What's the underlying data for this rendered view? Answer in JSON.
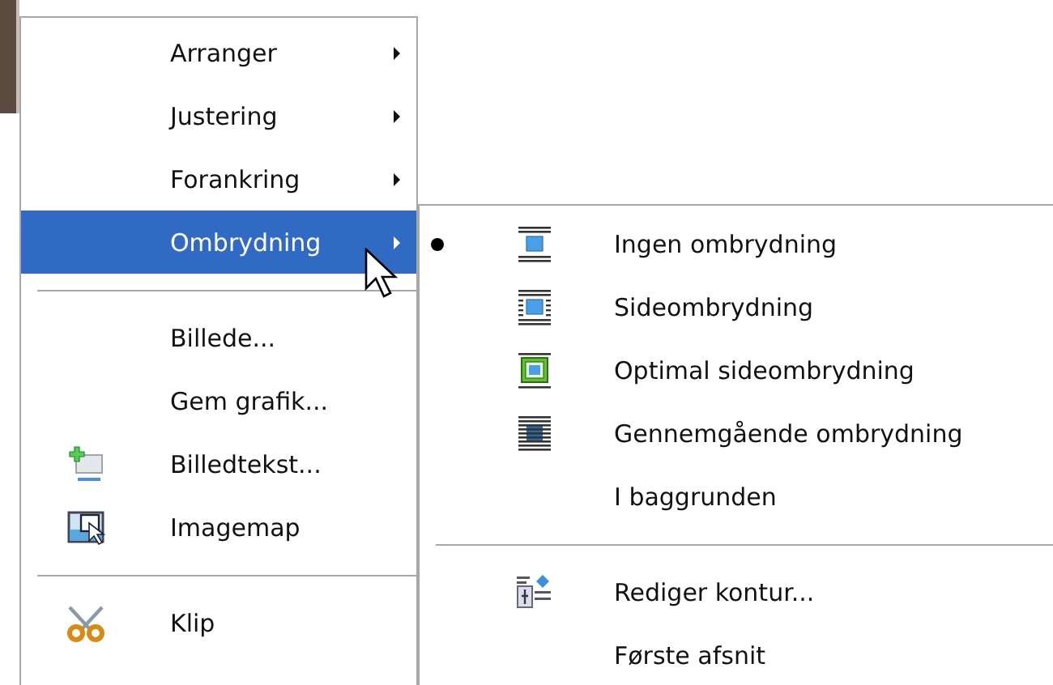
{
  "menu": {
    "items": [
      {
        "kind": "item",
        "label": "Arranger",
        "submenu": true,
        "selected": false
      },
      {
        "kind": "item",
        "label": "Justering",
        "submenu": true,
        "selected": false
      },
      {
        "kind": "item",
        "label": "Forankring",
        "submenu": true,
        "selected": false
      },
      {
        "kind": "item",
        "label": "Ombrydning",
        "submenu": true,
        "selected": true
      },
      {
        "kind": "separator"
      },
      {
        "kind": "item",
        "label": "Billede...",
        "selected": false
      },
      {
        "kind": "item",
        "label": "Gem grafik...",
        "selected": false
      },
      {
        "kind": "item",
        "label": "Billedtekst...",
        "selected": false
      },
      {
        "kind": "item",
        "label": "Imagemap",
        "selected": false
      },
      {
        "kind": "separator"
      },
      {
        "kind": "item",
        "label": "Klip",
        "selected": false
      }
    ]
  },
  "submenu": {
    "items": [
      {
        "kind": "radio",
        "label": "Ingen ombrydning",
        "checked": true
      },
      {
        "kind": "radio",
        "label": "Sideombrydning",
        "checked": false
      },
      {
        "kind": "radio",
        "label": "Optimal sideombrydning",
        "checked": false
      },
      {
        "kind": "radio",
        "label": "Gennemgående ombrydning",
        "checked": false
      },
      {
        "kind": "item",
        "label": "I baggrunden"
      },
      {
        "kind": "separator"
      },
      {
        "kind": "item",
        "label": "Rediger kontur..."
      },
      {
        "kind": "item",
        "label": "Første afsnit"
      }
    ]
  }
}
